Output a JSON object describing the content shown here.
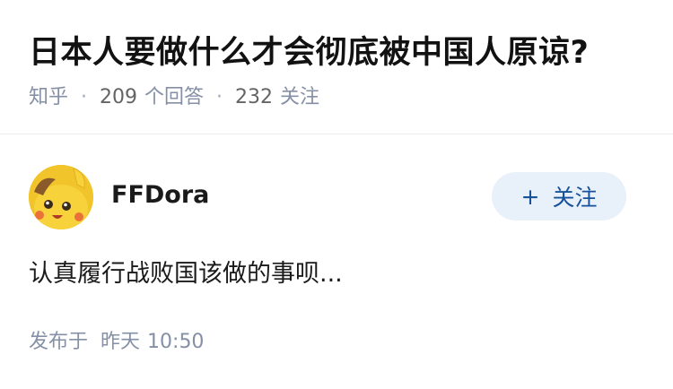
{
  "question": {
    "title": "日本人要做什么才会彻底被中国人原谅?",
    "source": "知乎",
    "answer_count": "209",
    "answer_unit": "个回答",
    "follower_count": "232",
    "follower_unit": "关注",
    "separator": "·"
  },
  "answer": {
    "author_name": "FFDora",
    "avatar_icon": "pikachu-avatar",
    "follow_label": "关注",
    "follow_icon": "+",
    "excerpt": "认真履行战败国该做的事呗...",
    "publish_prefix": "发布于",
    "publish_day": "昨天",
    "publish_time": "10:50"
  },
  "colors": {
    "accent": "#175199",
    "follow_bg": "#e8f0fa",
    "meta": "#8590a6",
    "avatar_bg": "#f7d23a"
  }
}
